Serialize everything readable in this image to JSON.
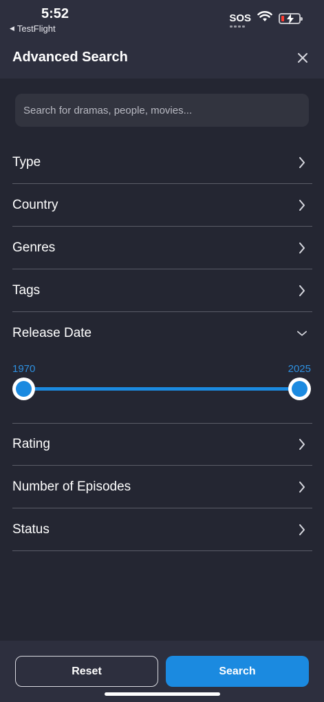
{
  "status_bar": {
    "time": "5:52",
    "back_app": "TestFlight",
    "sos": "SOS",
    "icons": [
      "wifi-icon",
      "battery-charging-icon"
    ],
    "battery_color": "#ff3b30"
  },
  "header": {
    "title": "Advanced Search",
    "close_icon": "close-icon"
  },
  "search": {
    "placeholder": "Search for dramas, people, movies..."
  },
  "filters": [
    {
      "label": "Type",
      "icon": "chevron-right-icon"
    },
    {
      "label": "Country",
      "icon": "chevron-right-icon"
    },
    {
      "label": "Genres",
      "icon": "chevron-right-icon"
    },
    {
      "label": "Tags",
      "icon": "chevron-right-icon"
    },
    {
      "label": "Release Date",
      "icon": "chevron-down-icon",
      "expanded": true
    },
    {
      "label": "Rating",
      "icon": "chevron-right-icon"
    },
    {
      "label": "Number of Episodes",
      "icon": "chevron-right-icon"
    },
    {
      "label": "Status",
      "icon": "chevron-right-icon"
    }
  ],
  "release_date": {
    "min": "1970",
    "max": "2025"
  },
  "actions": {
    "reset_label": "Reset",
    "search_label": "Search"
  },
  "colors": {
    "accent": "#1b8ae0",
    "background": "#242632",
    "header_bg": "#2d2f3e"
  }
}
